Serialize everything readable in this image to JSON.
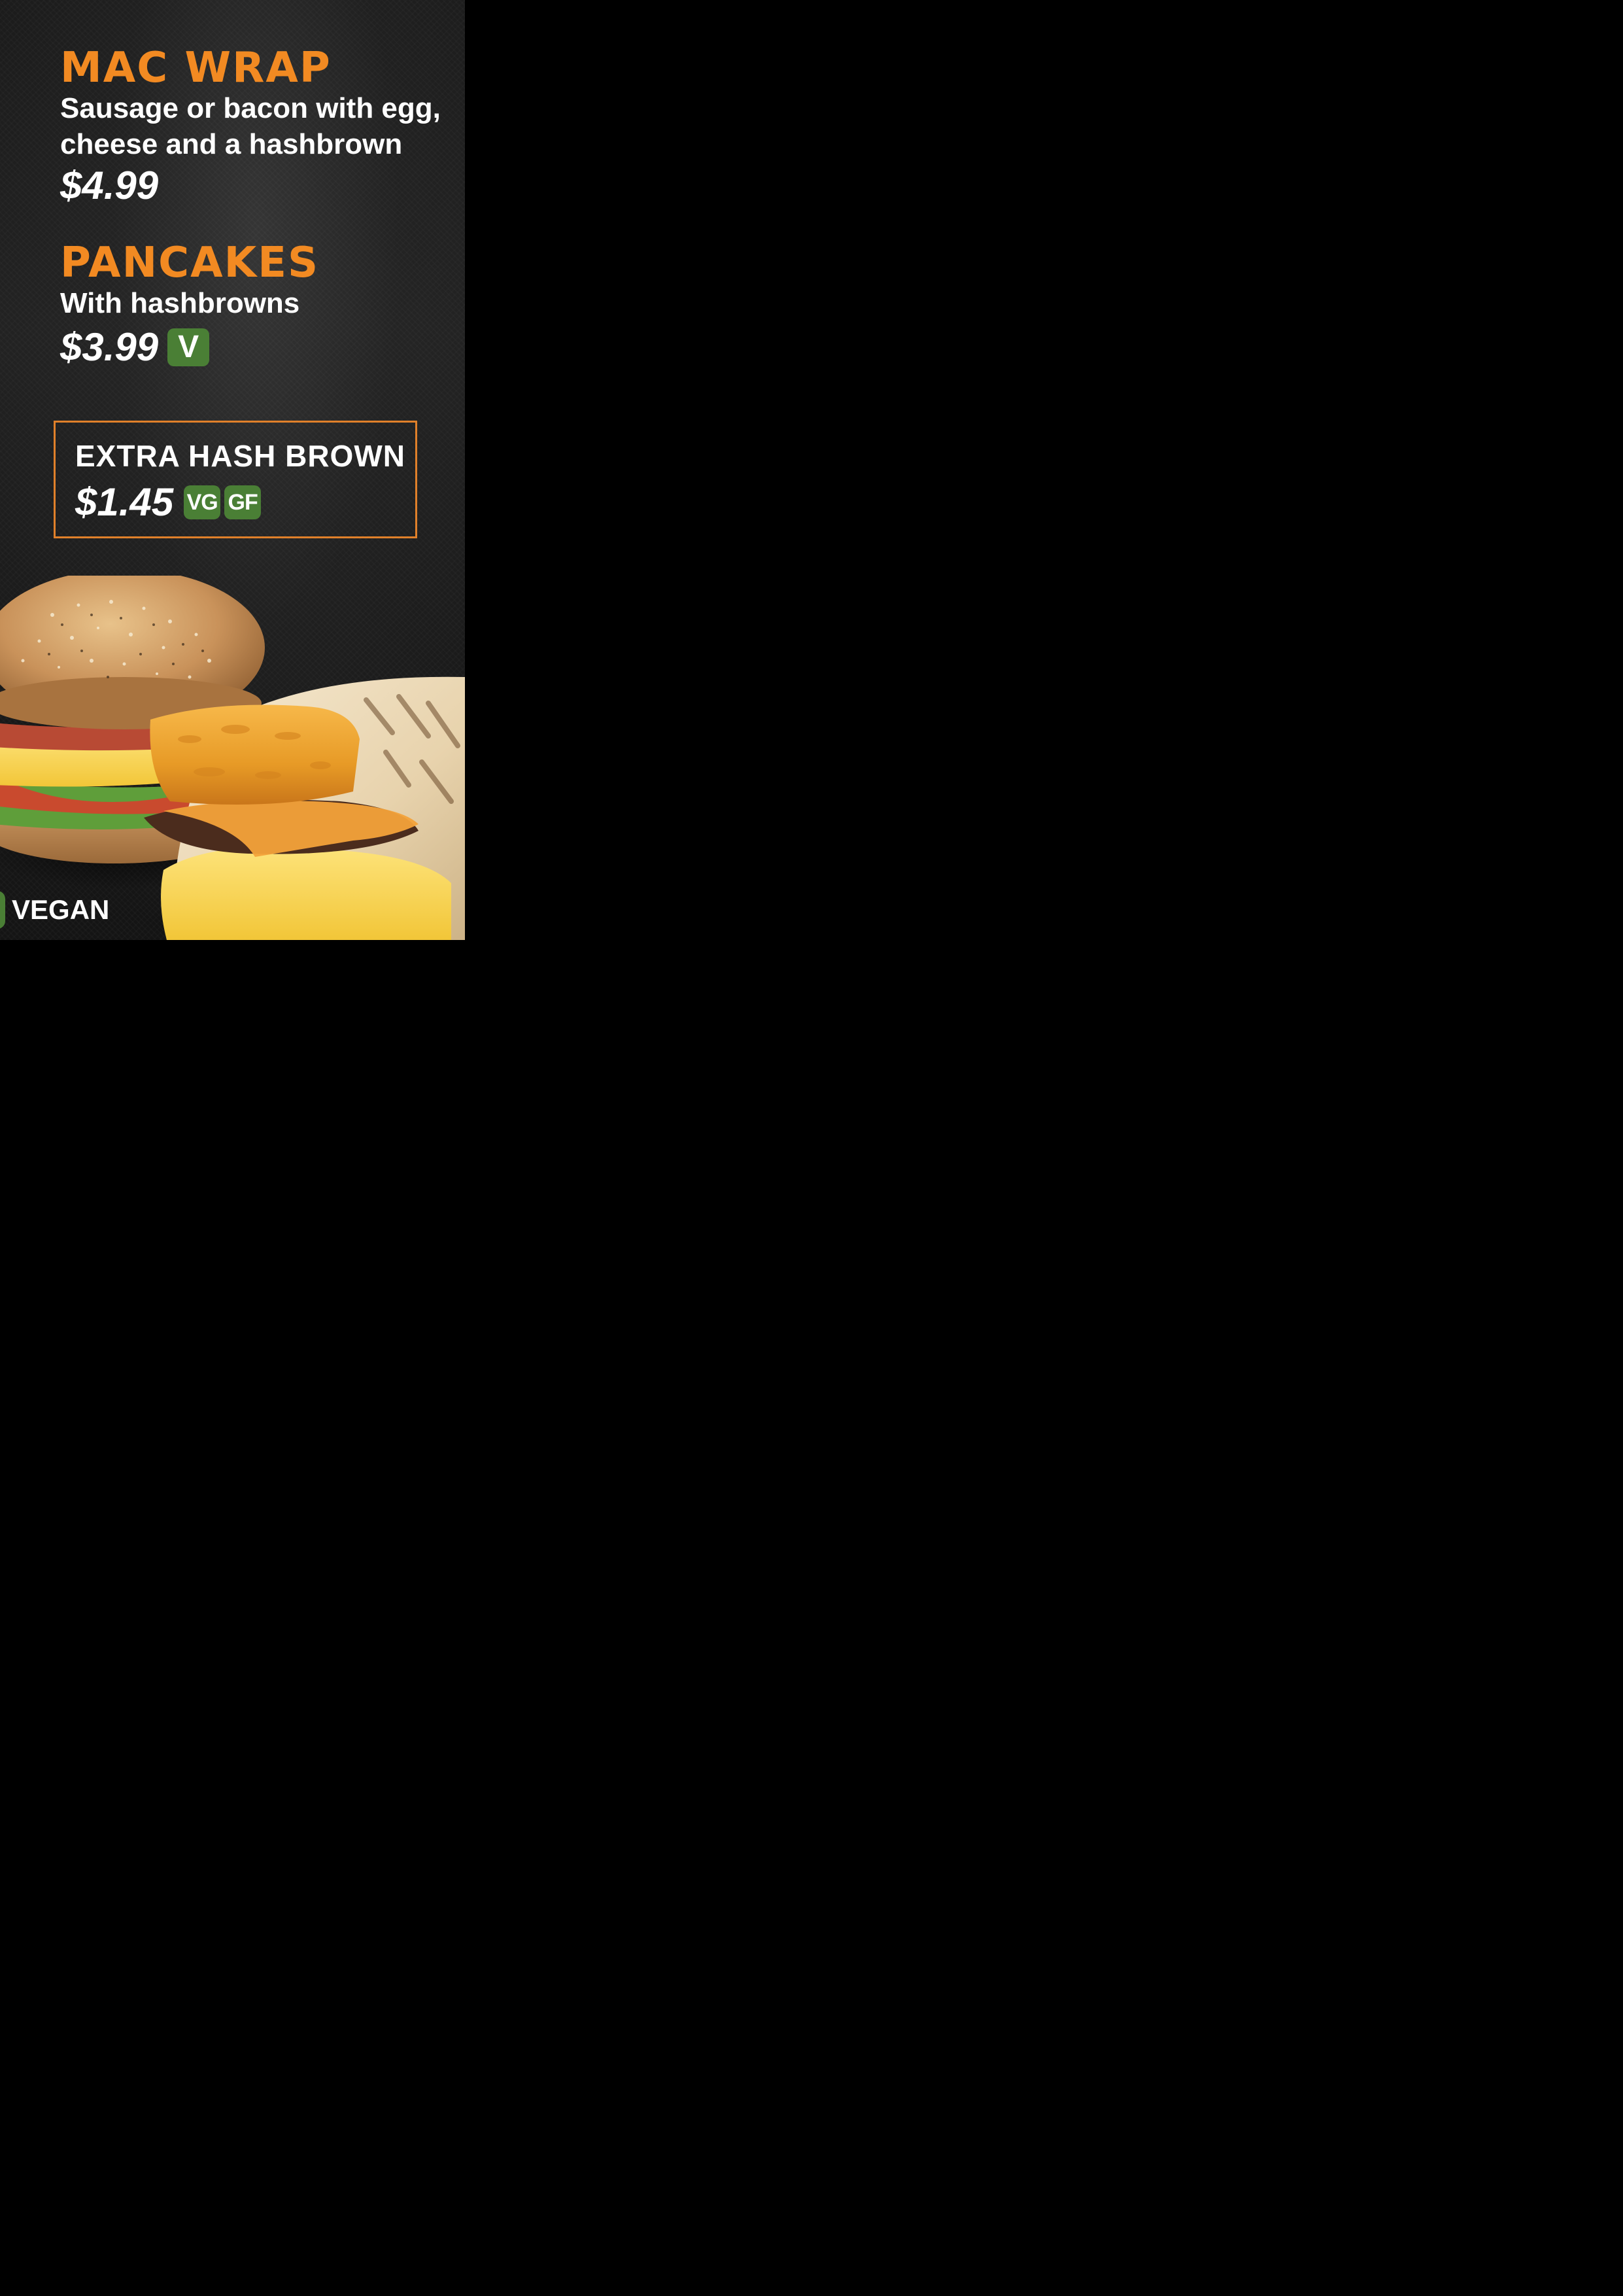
{
  "menu": {
    "items": [
      {
        "title": "MAC WRAP",
        "description_lines": [
          "Sausage or bacon with egg,",
          "cheese and a hashbrown"
        ],
        "price": "$4.99",
        "badges": []
      },
      {
        "title": "PANCAKES",
        "description_lines": [
          "With hashbrowns"
        ],
        "price": "$3.99",
        "badges": [
          "V"
        ]
      }
    ],
    "extra": {
      "title": "EXTRA HASH BROWN",
      "price": "$1.45",
      "badges": [
        "VG",
        "GF"
      ]
    },
    "legend": {
      "label": "VEGAN"
    }
  },
  "colors": {
    "title_orange": "#f28a22",
    "badge_green": "#4a7f35",
    "box_border": "#e0802a",
    "background": "#000000"
  },
  "images": {
    "food_photo": "breakfast-bagel-and-wrap-photo"
  }
}
